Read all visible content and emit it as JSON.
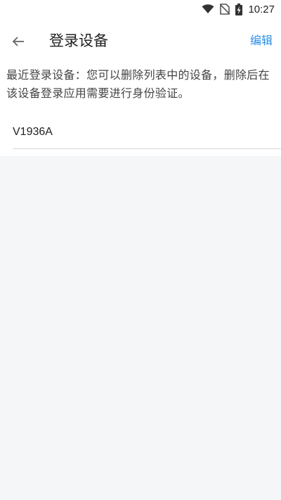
{
  "status_bar": {
    "time": "10:27",
    "icons": [
      "wifi-icon",
      "no-sim-icon",
      "battery-charging-icon"
    ]
  },
  "header": {
    "back_icon": "arrow-left-icon",
    "title": "登录设备",
    "edit_label": "编辑"
  },
  "description": "最近登录设备：您可以删除列表中的设备，删除后在该设备登录应用需要进行身份验证。",
  "devices": [
    {
      "name": "V1936A"
    }
  ],
  "colors": {
    "accent": "#2a8fe8",
    "background": "#f5f6f8",
    "surface": "#ffffff"
  }
}
